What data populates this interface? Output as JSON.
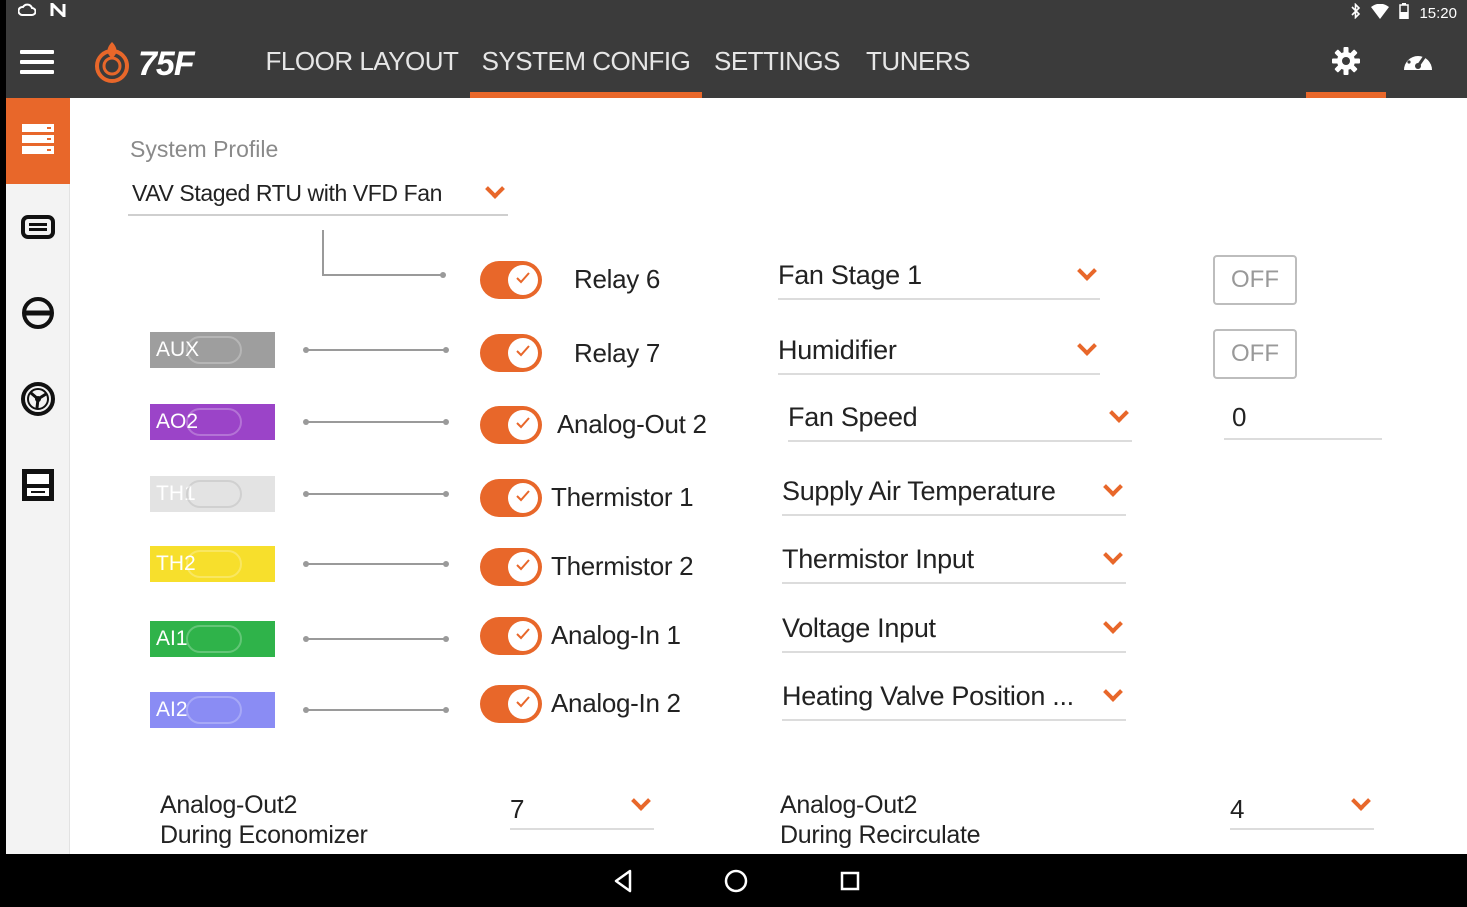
{
  "status_bar": {
    "time": "15:20"
  },
  "app": {
    "logo_text": "75F",
    "tabs": [
      {
        "label": "FLOOR LAYOUT",
        "active": false
      },
      {
        "label": "SYSTEM CONFIG",
        "active": true
      },
      {
        "label": "SETTINGS",
        "active": false
      },
      {
        "label": "TUNERS",
        "active": false
      }
    ],
    "accent_color": "#e8672a",
    "header_color": "#3b3b3b"
  },
  "sidebar": {
    "items": [
      {
        "icon": "server-stack-icon",
        "active": true
      },
      {
        "icon": "storage-bar-icon",
        "active": false
      },
      {
        "icon": "circle-slash-icon",
        "active": false
      },
      {
        "icon": "fan-dial-icon",
        "active": false
      },
      {
        "icon": "rtu-unit-icon",
        "active": false
      }
    ]
  },
  "system_profile": {
    "label": "System Profile",
    "value": "VAV Staged RTU with VFD Fan"
  },
  "ports": [
    {
      "badge": "",
      "badge_color": "",
      "enabled": true,
      "port": "Relay 6",
      "function": "Fan Stage 1",
      "output": "OFF"
    },
    {
      "badge": "AUX",
      "badge_color": "#9e9e9e",
      "enabled": true,
      "port": "Relay 7",
      "function": "Humidifier",
      "output": "OFF"
    },
    {
      "badge": "AO2",
      "badge_color": "#9b44c8",
      "enabled": true,
      "port": "Analog-Out 2",
      "function": "Fan Speed",
      "output": "0"
    },
    {
      "badge": "TH1",
      "badge_color": "#e3e3e3",
      "enabled": true,
      "port": "Thermistor 1",
      "function": "Supply Air Temperature",
      "output": ""
    },
    {
      "badge": "TH2",
      "badge_color": "#f7df2c",
      "enabled": true,
      "port": "Thermistor 2",
      "function": "Thermistor Input",
      "output": ""
    },
    {
      "badge": "AI1",
      "badge_color": "#2fb34a",
      "enabled": true,
      "port": "Analog-In 1",
      "function": "Voltage Input",
      "output": ""
    },
    {
      "badge": "AI2",
      "badge_color": "#8a8cf4",
      "enabled": true,
      "port": "Analog-In 2",
      "function": "Heating Valve Position ...",
      "output": ""
    }
  ],
  "bottom": {
    "economizer_label_1": "Analog-Out2",
    "economizer_label_2": "During Economizer",
    "economizer_value": "7",
    "recirculate_label_1": "Analog-Out2",
    "recirculate_label_2": "During Recirculate",
    "recirculate_value": "4"
  }
}
